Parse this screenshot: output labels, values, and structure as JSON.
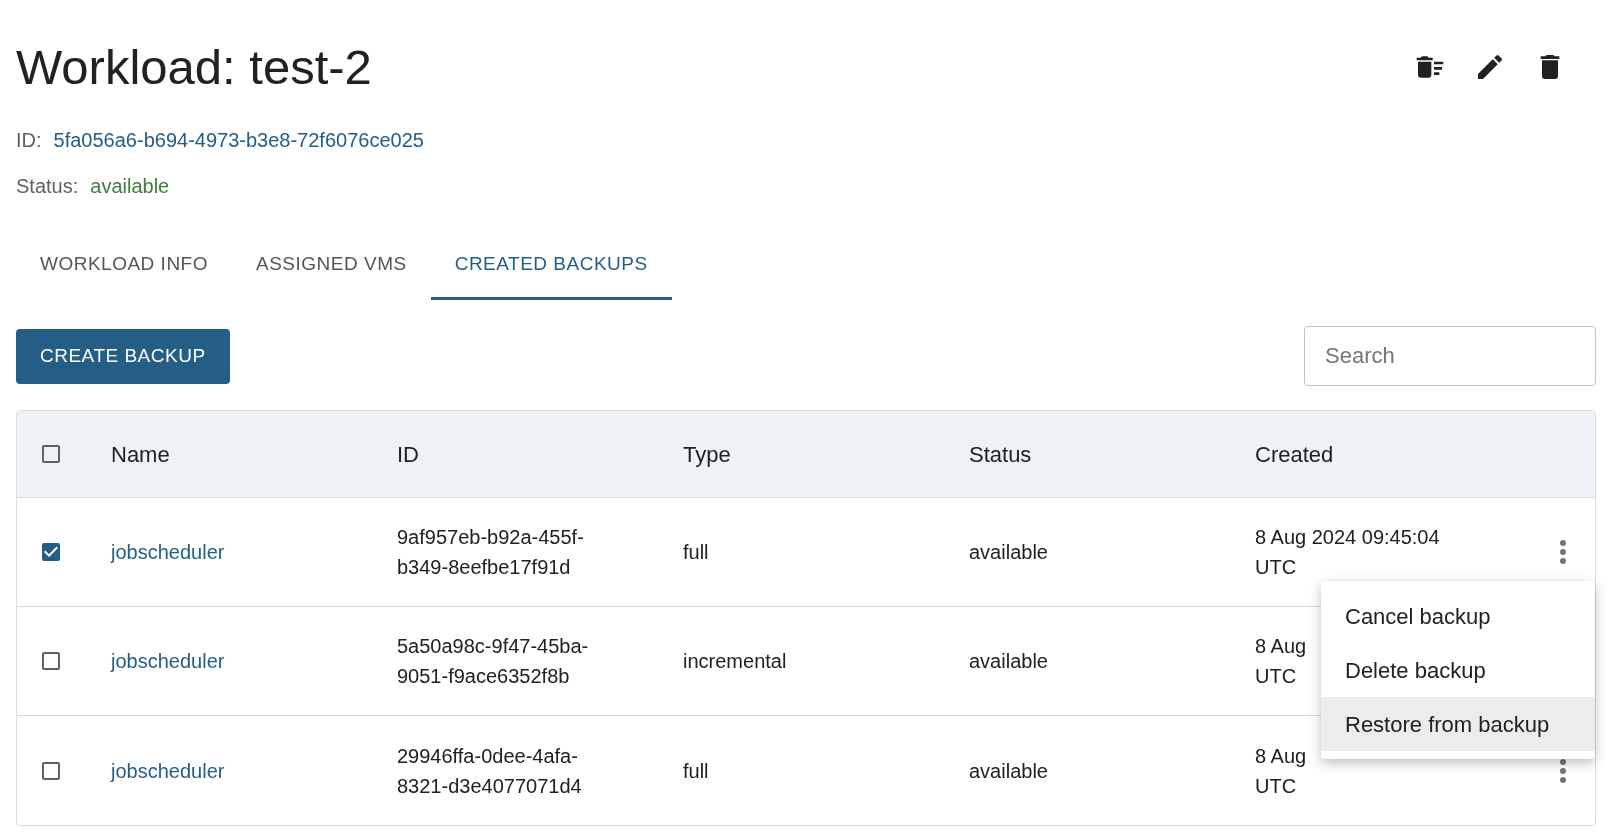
{
  "title": "Workload: test-2",
  "header_actions": [
    {
      "kind": "purge"
    },
    {
      "kind": "edit"
    },
    {
      "kind": "delete"
    }
  ],
  "id": {
    "label": "ID:",
    "value": "5fa056a6-b694-4973-b3e8-72f6076ce025"
  },
  "status": {
    "label": "Status:",
    "value": "available"
  },
  "tabs": [
    {
      "label": "WORKLOAD INFO",
      "selected": false
    },
    {
      "label": "ASSIGNED VMS",
      "selected": false
    },
    {
      "label": "CREATED BACKUPS",
      "selected": true
    }
  ],
  "create_button": "CREATE BACKUP",
  "search": {
    "placeholder": "Search"
  },
  "table": {
    "all_checked": false,
    "columns": [
      "Name",
      "ID",
      "Type",
      "Status",
      "Created"
    ],
    "rows": [
      {
        "checked": true,
        "name": "jobscheduler",
        "id": "9af957eb-b92a-455f-b349-8eefbe17f91d",
        "type": "full",
        "status": "available",
        "created": [
          "8 Aug 2024 09:45:04",
          "UTC"
        ]
      },
      {
        "checked": false,
        "name": "jobscheduler",
        "id": "5a50a98c-9f47-45ba-9051-f9ace6352f8b",
        "type": "incremental",
        "status": "available",
        "created": [
          "8 Aug",
          "UTC"
        ]
      },
      {
        "checked": false,
        "name": "jobscheduler",
        "id": "29946ffa-0dee-4afa-8321-d3e4077071d4",
        "type": "full",
        "status": "available",
        "created": [
          "8 Aug",
          "UTC"
        ]
      }
    ]
  },
  "menu": {
    "items": [
      {
        "label": "Cancel backup",
        "selected": false
      },
      {
        "label": "Delete backup",
        "selected": false
      },
      {
        "label": "Restore from backup",
        "selected": true
      }
    ]
  }
}
